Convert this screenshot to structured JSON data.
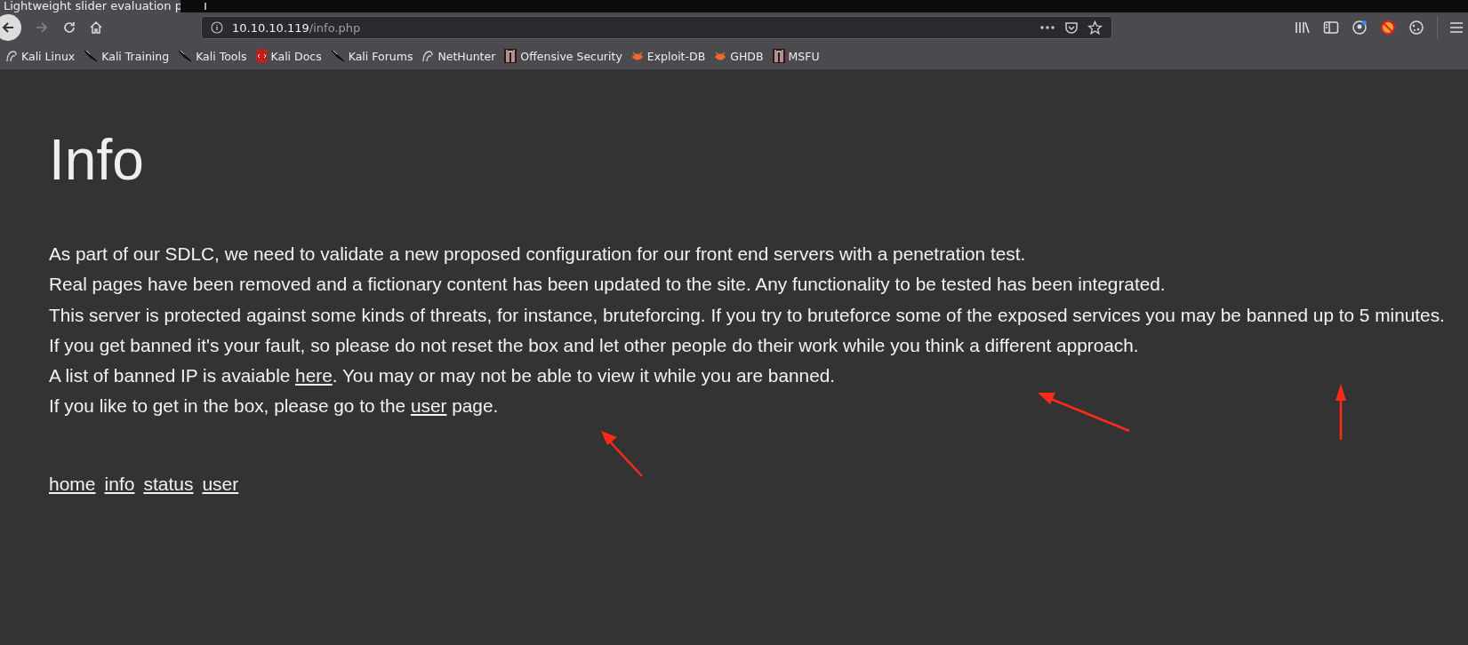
{
  "browser": {
    "tab_title": "Lightweight slider evaluation p",
    "url_host": "10.10.10.119",
    "url_path": "/info.php",
    "bookmarks": [
      {
        "label": "Kali Linux",
        "kind": "dragon"
      },
      {
        "label": "Kali Training",
        "kind": "knife"
      },
      {
        "label": "Kali Tools",
        "kind": "knife"
      },
      {
        "label": "Kali Docs",
        "kind": "doc"
      },
      {
        "label": "Kali Forums",
        "kind": "knife"
      },
      {
        "label": "NetHunter",
        "kind": "dragon"
      },
      {
        "label": "Offensive Security",
        "kind": "offsec"
      },
      {
        "label": "Exploit-DB",
        "kind": "bug"
      },
      {
        "label": "GHDB",
        "kind": "bug"
      },
      {
        "label": "MSFU",
        "kind": "offsec"
      }
    ]
  },
  "page": {
    "heading": "Info",
    "paragraphs": [
      {
        "text": "As part of our SDLC, we need to validate a new proposed configuration for our front end servers with a penetration test."
      },
      {
        "text": "Real pages have been removed and a fictionary content has been updated to the site. Any functionality to be tested has been integrated."
      },
      {
        "text": "This server is protected against some kinds of threats, for instance, bruteforcing. If you try to bruteforce some of the exposed services you may be banned up to 5 minutes."
      },
      {
        "text": "If you get banned it's your fault, so please do not reset the box and let other people do their work while you think a different approach."
      },
      {
        "before": "A list of banned IP is avaiable ",
        "link": "here",
        "after": ". You may or may not be able to view it while you are banned."
      },
      {
        "before": "If you like to get in the box, please go to the ",
        "link": "user",
        "after": " page."
      }
    ],
    "nav_links": [
      "home",
      "info",
      "status",
      "user"
    ]
  }
}
